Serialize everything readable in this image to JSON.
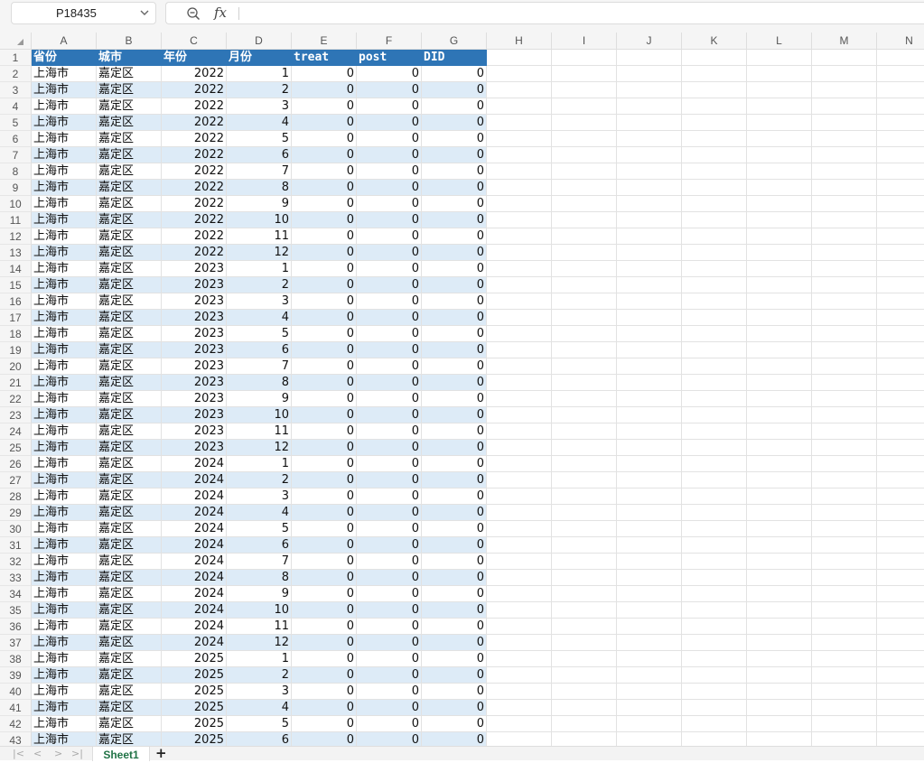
{
  "namebox": {
    "value": "P18435"
  },
  "formula": {
    "fx_label": "fx",
    "value": ""
  },
  "columns": [
    "A",
    "B",
    "C",
    "D",
    "E",
    "F",
    "G",
    "H",
    "I",
    "J",
    "K",
    "L",
    "M",
    "N"
  ],
  "header_row": [
    "省份",
    "城市",
    "年份",
    "月份",
    "treat",
    "post",
    "DID"
  ],
  "rows": [
    [
      "上海市",
      "嘉定区",
      "2022",
      "1",
      "0",
      "0",
      "0"
    ],
    [
      "上海市",
      "嘉定区",
      "2022",
      "2",
      "0",
      "0",
      "0"
    ],
    [
      "上海市",
      "嘉定区",
      "2022",
      "3",
      "0",
      "0",
      "0"
    ],
    [
      "上海市",
      "嘉定区",
      "2022",
      "4",
      "0",
      "0",
      "0"
    ],
    [
      "上海市",
      "嘉定区",
      "2022",
      "5",
      "0",
      "0",
      "0"
    ],
    [
      "上海市",
      "嘉定区",
      "2022",
      "6",
      "0",
      "0",
      "0"
    ],
    [
      "上海市",
      "嘉定区",
      "2022",
      "7",
      "0",
      "0",
      "0"
    ],
    [
      "上海市",
      "嘉定区",
      "2022",
      "8",
      "0",
      "0",
      "0"
    ],
    [
      "上海市",
      "嘉定区",
      "2022",
      "9",
      "0",
      "0",
      "0"
    ],
    [
      "上海市",
      "嘉定区",
      "2022",
      "10",
      "0",
      "0",
      "0"
    ],
    [
      "上海市",
      "嘉定区",
      "2022",
      "11",
      "0",
      "0",
      "0"
    ],
    [
      "上海市",
      "嘉定区",
      "2022",
      "12",
      "0",
      "0",
      "0"
    ],
    [
      "上海市",
      "嘉定区",
      "2023",
      "1",
      "0",
      "0",
      "0"
    ],
    [
      "上海市",
      "嘉定区",
      "2023",
      "2",
      "0",
      "0",
      "0"
    ],
    [
      "上海市",
      "嘉定区",
      "2023",
      "3",
      "0",
      "0",
      "0"
    ],
    [
      "上海市",
      "嘉定区",
      "2023",
      "4",
      "0",
      "0",
      "0"
    ],
    [
      "上海市",
      "嘉定区",
      "2023",
      "5",
      "0",
      "0",
      "0"
    ],
    [
      "上海市",
      "嘉定区",
      "2023",
      "6",
      "0",
      "0",
      "0"
    ],
    [
      "上海市",
      "嘉定区",
      "2023",
      "7",
      "0",
      "0",
      "0"
    ],
    [
      "上海市",
      "嘉定区",
      "2023",
      "8",
      "0",
      "0",
      "0"
    ],
    [
      "上海市",
      "嘉定区",
      "2023",
      "9",
      "0",
      "0",
      "0"
    ],
    [
      "上海市",
      "嘉定区",
      "2023",
      "10",
      "0",
      "0",
      "0"
    ],
    [
      "上海市",
      "嘉定区",
      "2023",
      "11",
      "0",
      "0",
      "0"
    ],
    [
      "上海市",
      "嘉定区",
      "2023",
      "12",
      "0",
      "0",
      "0"
    ],
    [
      "上海市",
      "嘉定区",
      "2024",
      "1",
      "0",
      "0",
      "0"
    ],
    [
      "上海市",
      "嘉定区",
      "2024",
      "2",
      "0",
      "0",
      "0"
    ],
    [
      "上海市",
      "嘉定区",
      "2024",
      "3",
      "0",
      "0",
      "0"
    ],
    [
      "上海市",
      "嘉定区",
      "2024",
      "4",
      "0",
      "0",
      "0"
    ],
    [
      "上海市",
      "嘉定区",
      "2024",
      "5",
      "0",
      "0",
      "0"
    ],
    [
      "上海市",
      "嘉定区",
      "2024",
      "6",
      "0",
      "0",
      "0"
    ],
    [
      "上海市",
      "嘉定区",
      "2024",
      "7",
      "0",
      "0",
      "0"
    ],
    [
      "上海市",
      "嘉定区",
      "2024",
      "8",
      "0",
      "0",
      "0"
    ],
    [
      "上海市",
      "嘉定区",
      "2024",
      "9",
      "0",
      "0",
      "0"
    ],
    [
      "上海市",
      "嘉定区",
      "2024",
      "10",
      "0",
      "0",
      "0"
    ],
    [
      "上海市",
      "嘉定区",
      "2024",
      "11",
      "0",
      "0",
      "0"
    ],
    [
      "上海市",
      "嘉定区",
      "2024",
      "12",
      "0",
      "0",
      "0"
    ],
    [
      "上海市",
      "嘉定区",
      "2025",
      "1",
      "0",
      "0",
      "0"
    ],
    [
      "上海市",
      "嘉定区",
      "2025",
      "2",
      "0",
      "0",
      "0"
    ],
    [
      "上海市",
      "嘉定区",
      "2025",
      "3",
      "0",
      "0",
      "0"
    ],
    [
      "上海市",
      "嘉定区",
      "2025",
      "4",
      "0",
      "0",
      "0"
    ],
    [
      "上海市",
      "嘉定区",
      "2025",
      "5",
      "0",
      "0",
      "0"
    ],
    [
      "上海市",
      "嘉定区",
      "2025",
      "6",
      "0",
      "0",
      "0"
    ]
  ],
  "sheet_tabs": [
    {
      "label": "Sheet1",
      "active": true
    }
  ],
  "tab_nav_icons": [
    "first-sheet-icon",
    "prev-sheet-icon",
    "next-sheet-icon",
    "last-sheet-icon"
  ],
  "add_sheet_label": "+",
  "colors": {
    "header_fill": "#2e75b6",
    "band_fill": "#ddebf7",
    "active_tab_text": "#217346"
  }
}
